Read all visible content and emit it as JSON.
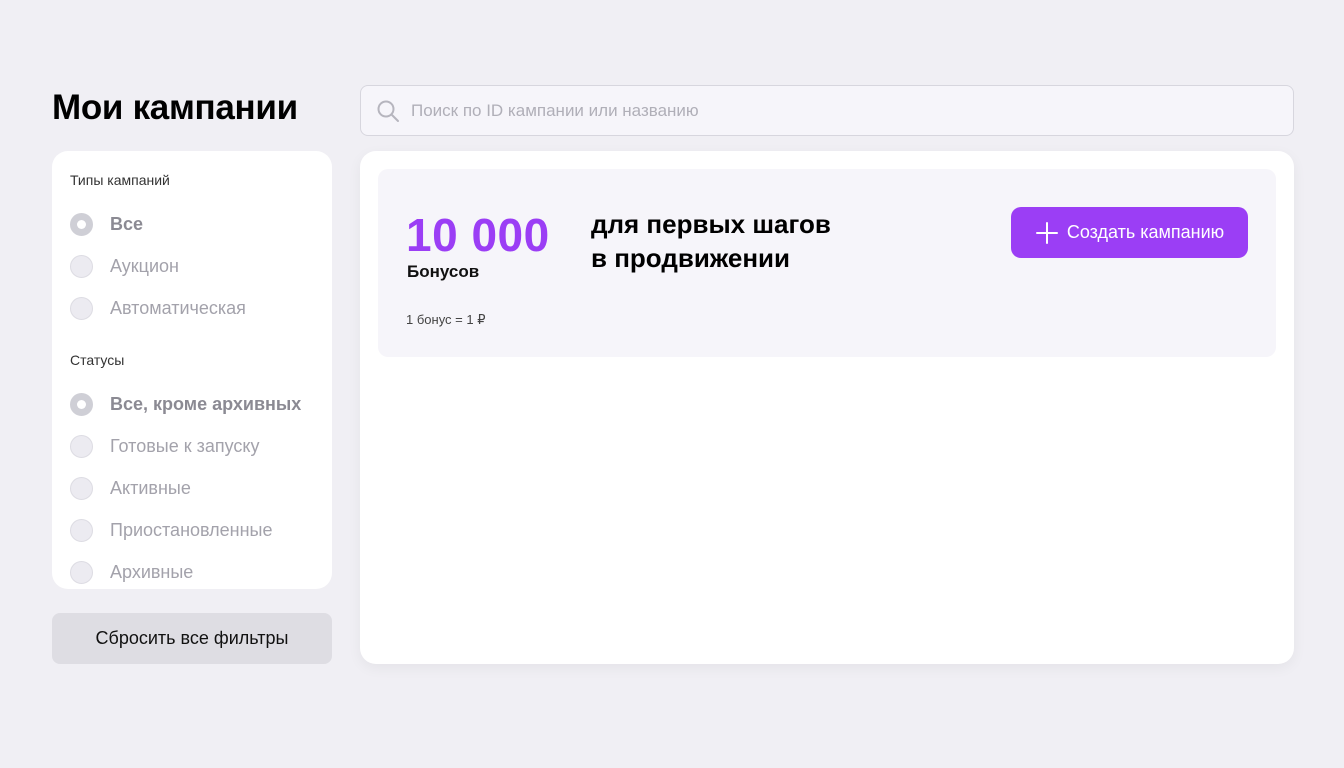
{
  "page": {
    "title": "Мои кампании"
  },
  "search": {
    "placeholder": "Поиск по ID кампании или названию",
    "value": ""
  },
  "filters": {
    "campaign_types": {
      "title": "Типы кампаний",
      "options": [
        {
          "label": "Все",
          "checked": true
        },
        {
          "label": "Аукцион",
          "checked": false
        },
        {
          "label": "Автоматическая",
          "checked": false
        }
      ]
    },
    "statuses": {
      "title": "Статусы",
      "options": [
        {
          "label": "Все, кроме архивных",
          "checked": true
        },
        {
          "label": "Готовые к запуску",
          "checked": false
        },
        {
          "label": "Активные",
          "checked": false
        },
        {
          "label": "Приостановленные",
          "checked": false
        },
        {
          "label": "Архивные",
          "checked": false
        }
      ]
    },
    "reset_label": "Сбросить все фильтры"
  },
  "promo": {
    "amount": "10 000",
    "unit": "Бонусов",
    "text_line1": "для первых шагов",
    "text_line2": "в продвижении",
    "rate": "1 бонус = 1 ₽",
    "create_label": "Создать кампанию"
  },
  "colors": {
    "accent": "#9b3ef5",
    "background": "#f0eff4",
    "card": "#ffffff",
    "promo_bg": "#f6f5fa"
  },
  "icons": {
    "search": "search-icon",
    "plus": "plus-icon"
  }
}
